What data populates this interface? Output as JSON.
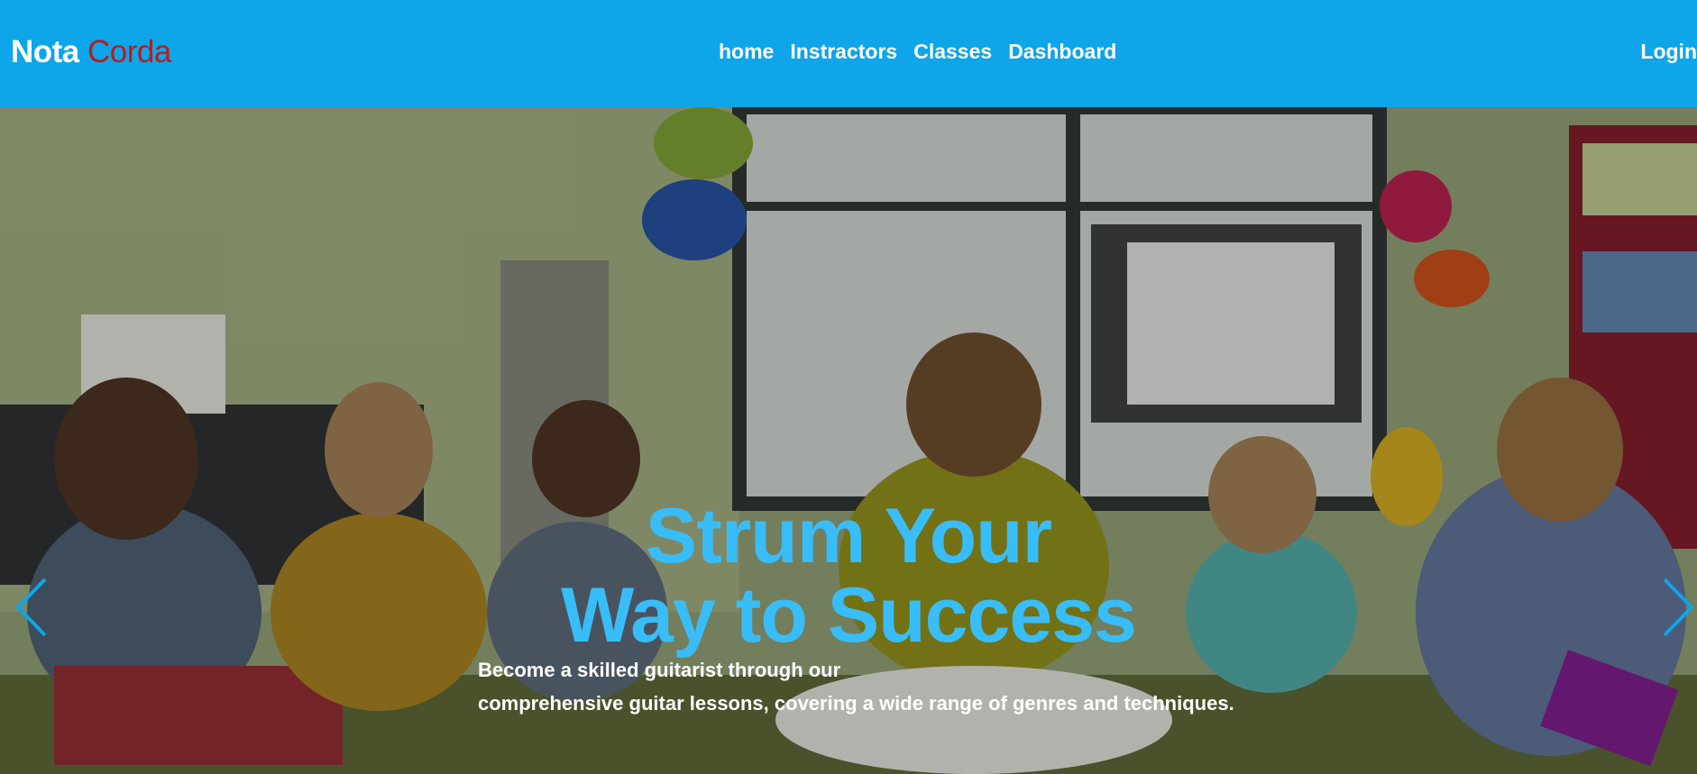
{
  "brand": {
    "name_part1": "Nota",
    "name_part2": "Corda"
  },
  "nav": {
    "links": [
      "home",
      "Instractors",
      "Classes",
      "Dashboard"
    ],
    "login": "Login"
  },
  "hero": {
    "title_line1": "Strum Your",
    "title_line2": "Way to Success",
    "subtitle_line1": "Become a skilled guitarist through our",
    "subtitle_line2": "comprehensive guitar lessons, covering a wide range of genres and techniques.",
    "prev_icon": "chevron-left-icon",
    "next_icon": "chevron-right-icon"
  },
  "colors": {
    "navbar": "#0ea5e9",
    "brand_accent": "#b91c1c",
    "title": "#38bdf8",
    "arrows": "#0ea5e9"
  }
}
